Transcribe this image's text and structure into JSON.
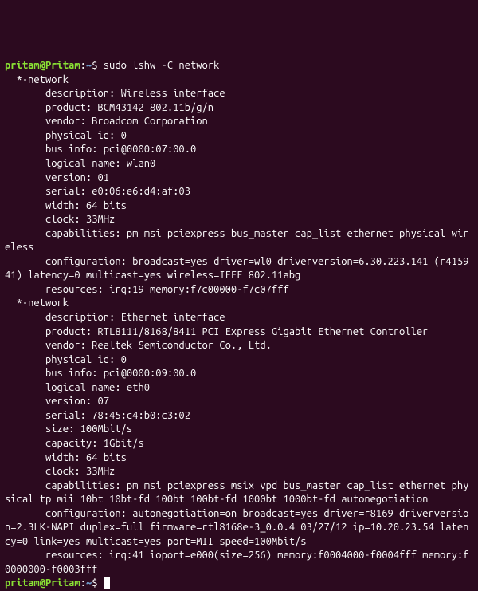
{
  "prompt": {
    "user": "pritam",
    "host": "Pritam",
    "path": "~",
    "symbol": "$"
  },
  "command": "sudo lshw -C network",
  "output": {
    "net1": {
      "header": "  *-network",
      "description": "       description: Wireless interface",
      "product": "       product: BCM43142 802.11b/g/n",
      "vendor": "       vendor: Broadcom Corporation",
      "physical_id": "       physical id: 0",
      "bus_info": "       bus info: pci@0000:07:00.0",
      "logical_name": "       logical name: wlan0",
      "version": "       version: 01",
      "serial": "       serial: e0:06:e6:d4:af:03",
      "width": "       width: 64 bits",
      "clock": "       clock: 33MHz",
      "capabilities": "       capabilities: pm msi pciexpress bus_master cap_list ethernet physical wireless",
      "configuration": "       configuration: broadcast=yes driver=wl0 driverversion=6.30.223.141 (r415941) latency=0 multicast=yes wireless=IEEE 802.11abg",
      "resources": "       resources: irq:19 memory:f7c00000-f7c07fff"
    },
    "net2": {
      "header": "  *-network",
      "description": "       description: Ethernet interface",
      "product": "       product: RTL8111/8168/8411 PCI Express Gigabit Ethernet Controller",
      "vendor": "       vendor: Realtek Semiconductor Co., Ltd.",
      "physical_id": "       physical id: 0",
      "bus_info": "       bus info: pci@0000:09:00.0",
      "logical_name": "       logical name: eth0",
      "version": "       version: 07",
      "serial": "       serial: 78:45:c4:b0:c3:02",
      "size": "       size: 100Mbit/s",
      "capacity": "       capacity: 1Gbit/s",
      "width": "       width: 64 bits",
      "clock": "       clock: 33MHz",
      "capabilities": "       capabilities: pm msi pciexpress msix vpd bus_master cap_list ethernet physical tp mii 10bt 10bt-fd 100bt 100bt-fd 1000bt 1000bt-fd autonegotiation",
      "configuration": "       configuration: autonegotiation=on broadcast=yes driver=r8169 driverversion=2.3LK-NAPI duplex=full firmware=rtl8168e-3_0.0.4 03/27/12 ip=10.20.23.54 latency=0 link=yes multicast=yes port=MII speed=100Mbit/s",
      "resources": "       resources: irq:41 ioport=e000(size=256) memory:f0004000-f0004fff memory:f0000000-f0003fff"
    }
  }
}
